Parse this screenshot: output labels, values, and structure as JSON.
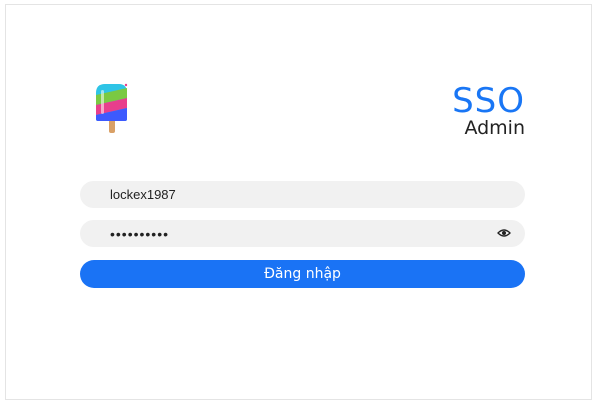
{
  "brand": {
    "title": "SSO",
    "subtitle": "Admin",
    "logo_icon": "popsicle-icon"
  },
  "login_form": {
    "username_value": "lockex1987",
    "password_value": "lockex1987",
    "password_toggle_icon": "eye-icon",
    "submit_label": "Đăng nhập"
  },
  "colors": {
    "accent": "#1a73f5",
    "field_bg": "#f1f1f1"
  }
}
